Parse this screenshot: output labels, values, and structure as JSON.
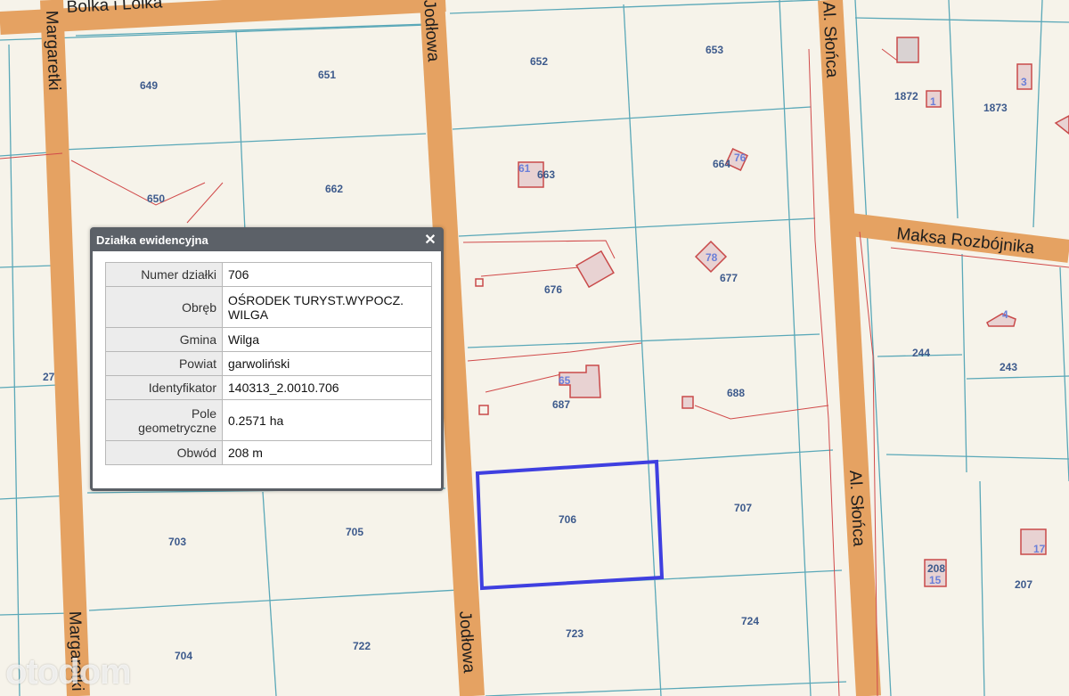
{
  "streets": {
    "bolka": "Bolka i Lolka",
    "margaretki_top": "Margaretki",
    "margaretki_bottom": "Margaretki",
    "jodlowa_top": "Jodłowa",
    "jodlowa_bottom": "Jodłowa",
    "slonca_top": "Al. Słońca",
    "slonca_bottom": "Al. Słońca",
    "maksa": "Maksa Rozbójnika"
  },
  "plots": {
    "p649": "649",
    "p650": "650",
    "p651": "651",
    "p662": "662",
    "p652": "652",
    "p653": "653",
    "p663": "663",
    "p664": "664",
    "p676": "676",
    "p677": "677",
    "p687": "687",
    "p688": "688",
    "p706": "706",
    "p707": "707",
    "p703": "703",
    "p705": "705",
    "p704": "704",
    "p722": "722",
    "p723": "723",
    "p724": "724",
    "p1872": "1872",
    "p1873": "1873",
    "p244": "244",
    "p243": "243",
    "p208": "208",
    "p207": "207",
    "p27": "27"
  },
  "buildings": {
    "b61": "61",
    "b76": "76",
    "b78": "78",
    "b65": "65",
    "b3": "3",
    "b1": "1",
    "b4": "4",
    "b15": "15",
    "b17": "17"
  },
  "popup": {
    "title": "Działka ewidencyjna",
    "close": "✕",
    "rows": [
      {
        "key": "Numer działki",
        "value": "706"
      },
      {
        "key": "Obręb",
        "value": "OŚRODEK TURYST.WYPOCZ. WILGA"
      },
      {
        "key": "Gmina",
        "value": "Wilga"
      },
      {
        "key": "Powiat",
        "value": "garwoliński"
      },
      {
        "key": "Identyfikator",
        "value": "140313_2.0010.706"
      },
      {
        "key": "Pole geometryczne",
        "value": "0.2571 ha"
      },
      {
        "key": "Obwód",
        "value": "208 m"
      }
    ]
  },
  "watermark": "otodom",
  "colors": {
    "road": "#e5a262",
    "parcel_line": "#5aa8b8",
    "building_outline": "#c94a4a",
    "selection": "#3f3fe0",
    "background": "#f6f3ea"
  }
}
